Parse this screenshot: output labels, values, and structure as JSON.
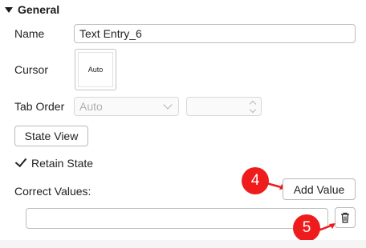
{
  "section": {
    "title": "General"
  },
  "name_field": {
    "label": "Name",
    "value": "Text Entry_6"
  },
  "cursor": {
    "label": "Cursor",
    "value": "Auto"
  },
  "tab_order": {
    "label": "Tab Order",
    "select_value": "Auto",
    "number_value": ""
  },
  "buttons": {
    "state_view": "State View",
    "add_value": "Add Value"
  },
  "retain_state": {
    "label": "Retain State",
    "checked": true
  },
  "correct_values": {
    "label": "Correct Values:",
    "entries": [
      ""
    ]
  },
  "annotations": {
    "badge_4": "4",
    "badge_5": "5",
    "color": "#ee1c1c"
  },
  "icons": {
    "section_toggle": "caret-down-icon",
    "delete": "trash-icon",
    "select": "chevron-down-icon",
    "spinner": "spinner-arrows-icon",
    "check": "checkmark-icon"
  }
}
